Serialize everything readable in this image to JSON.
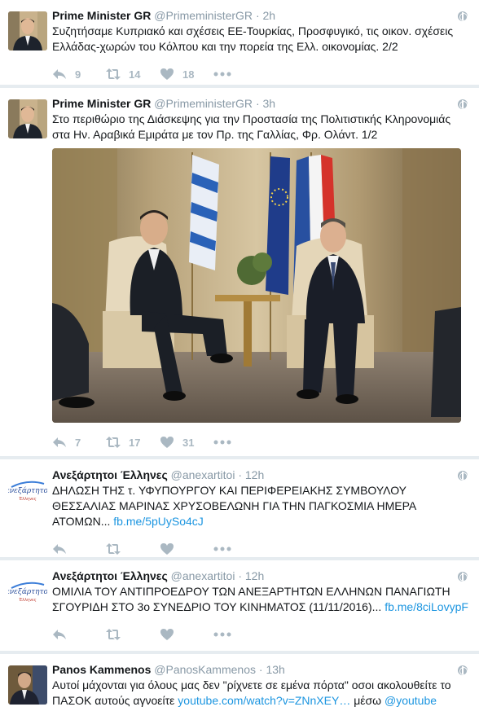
{
  "tweets": [
    {
      "name": "Prime Minister GR",
      "handle": "@PrimeministerGR",
      "separator": "·",
      "time": "2h",
      "text": "Συζητήσαμε Κυπριακό και σχέσεις ΕΕ-Τουρκίας, Προσφυγικό, τις οικον. σχέσεις Ελλάδας-χωρών του Κόλπου και την πορεία της Ελλ. οικονομίας. 2/2",
      "replies": "9",
      "retweets": "14",
      "likes": "18"
    },
    {
      "name": "Prime Minister GR",
      "handle": "@PrimeministerGR",
      "separator": "·",
      "time": "3h",
      "text": "Στο περιθώριο της Διάσκεψης για την Προστασία της Πολιτιστικής Κληρονομιάς στα Ην. Αραβικά Εμιράτα με τον Πρ. της Γαλλίας, Φρ. Ολάντ. 1/2",
      "replies": "7",
      "retweets": "17",
      "likes": "31"
    },
    {
      "name": "Ανεξάρτητοι Έλληνες",
      "handle": "@anexartitoi",
      "separator": "·",
      "time": "12h",
      "text": "ΔΗΛΩΣΗ ΤΗΣ τ. ΥΦΥΠΟΥΡΓΟΥ ΚΑΙ ΠΕΡΙΦΕΡΕΙΑΚΗΣ ΣΥΜΒΟΥΛΟΥ ΘΕΣΣΑΛΙΑΣ ΜΑΡΙΝΑΣ ΧΡΥΣΟΒΕΛΩΝΗ ΓΙΑ ΤΗΝ ΠΑΓΚΟΣΜΙΑ ΗΜΕΡΑ ΑΤΟΜΩΝ...",
      "link": "fb.me/5pUySo4cJ",
      "logo_text": "ανεξάρτητοι",
      "logo_subtext": "Έλληνες"
    },
    {
      "name": "Ανεξάρτητοι Έλληνες",
      "handle": "@anexartitoi",
      "separator": "·",
      "time": "12h",
      "text": "ΟΜΙΛΙΑ ΤΟΥ ΑΝΤΙΠΡΟΕΔΡΟΥ ΤΩΝ ΑΝΕΞΑΡΤΗΤΩΝ ΕΛΛΗΝΩΝ ΠΑΝΑΓΙΩΤΗ ΣΓΟΥΡΙΔΗ ΣΤΟ 3ο ΣΥΝΕΔΡΙΟ ΤΟΥ ΚΙΝΗΜΑΤΟΣ (11/11/2016)...",
      "link": "fb.me/8ciLovypF",
      "logo_text": "ανεξάρτητοι",
      "logo_subtext": "Έλληνες"
    },
    {
      "name": "Panos Kammenos",
      "handle": "@PanosKammenos",
      "separator": "·",
      "time": "13h",
      "text": "Αυτοί μάχονται για όλους μας δεν \"ρίχνετε σε εμένα πόρτα\" οσοι ακολουθείτε το ΠΑΣΟΚ  αυτούς αγνοείτε",
      "link": "youtube.com/watch?v=ZNnXEY…",
      "text_after_link": " μέσω ",
      "mention": "@youtube"
    }
  ],
  "colors": {
    "name": "#14171a",
    "muted": "#8899a6",
    "icon": "#aab8c2",
    "link": "#1b95e0",
    "background": "#e6ecf0"
  },
  "icons": {
    "reply": "reply-icon",
    "retweet": "retweet-icon",
    "like": "heart-icon",
    "more": "more-dots-icon",
    "globe": "globe-icon"
  }
}
